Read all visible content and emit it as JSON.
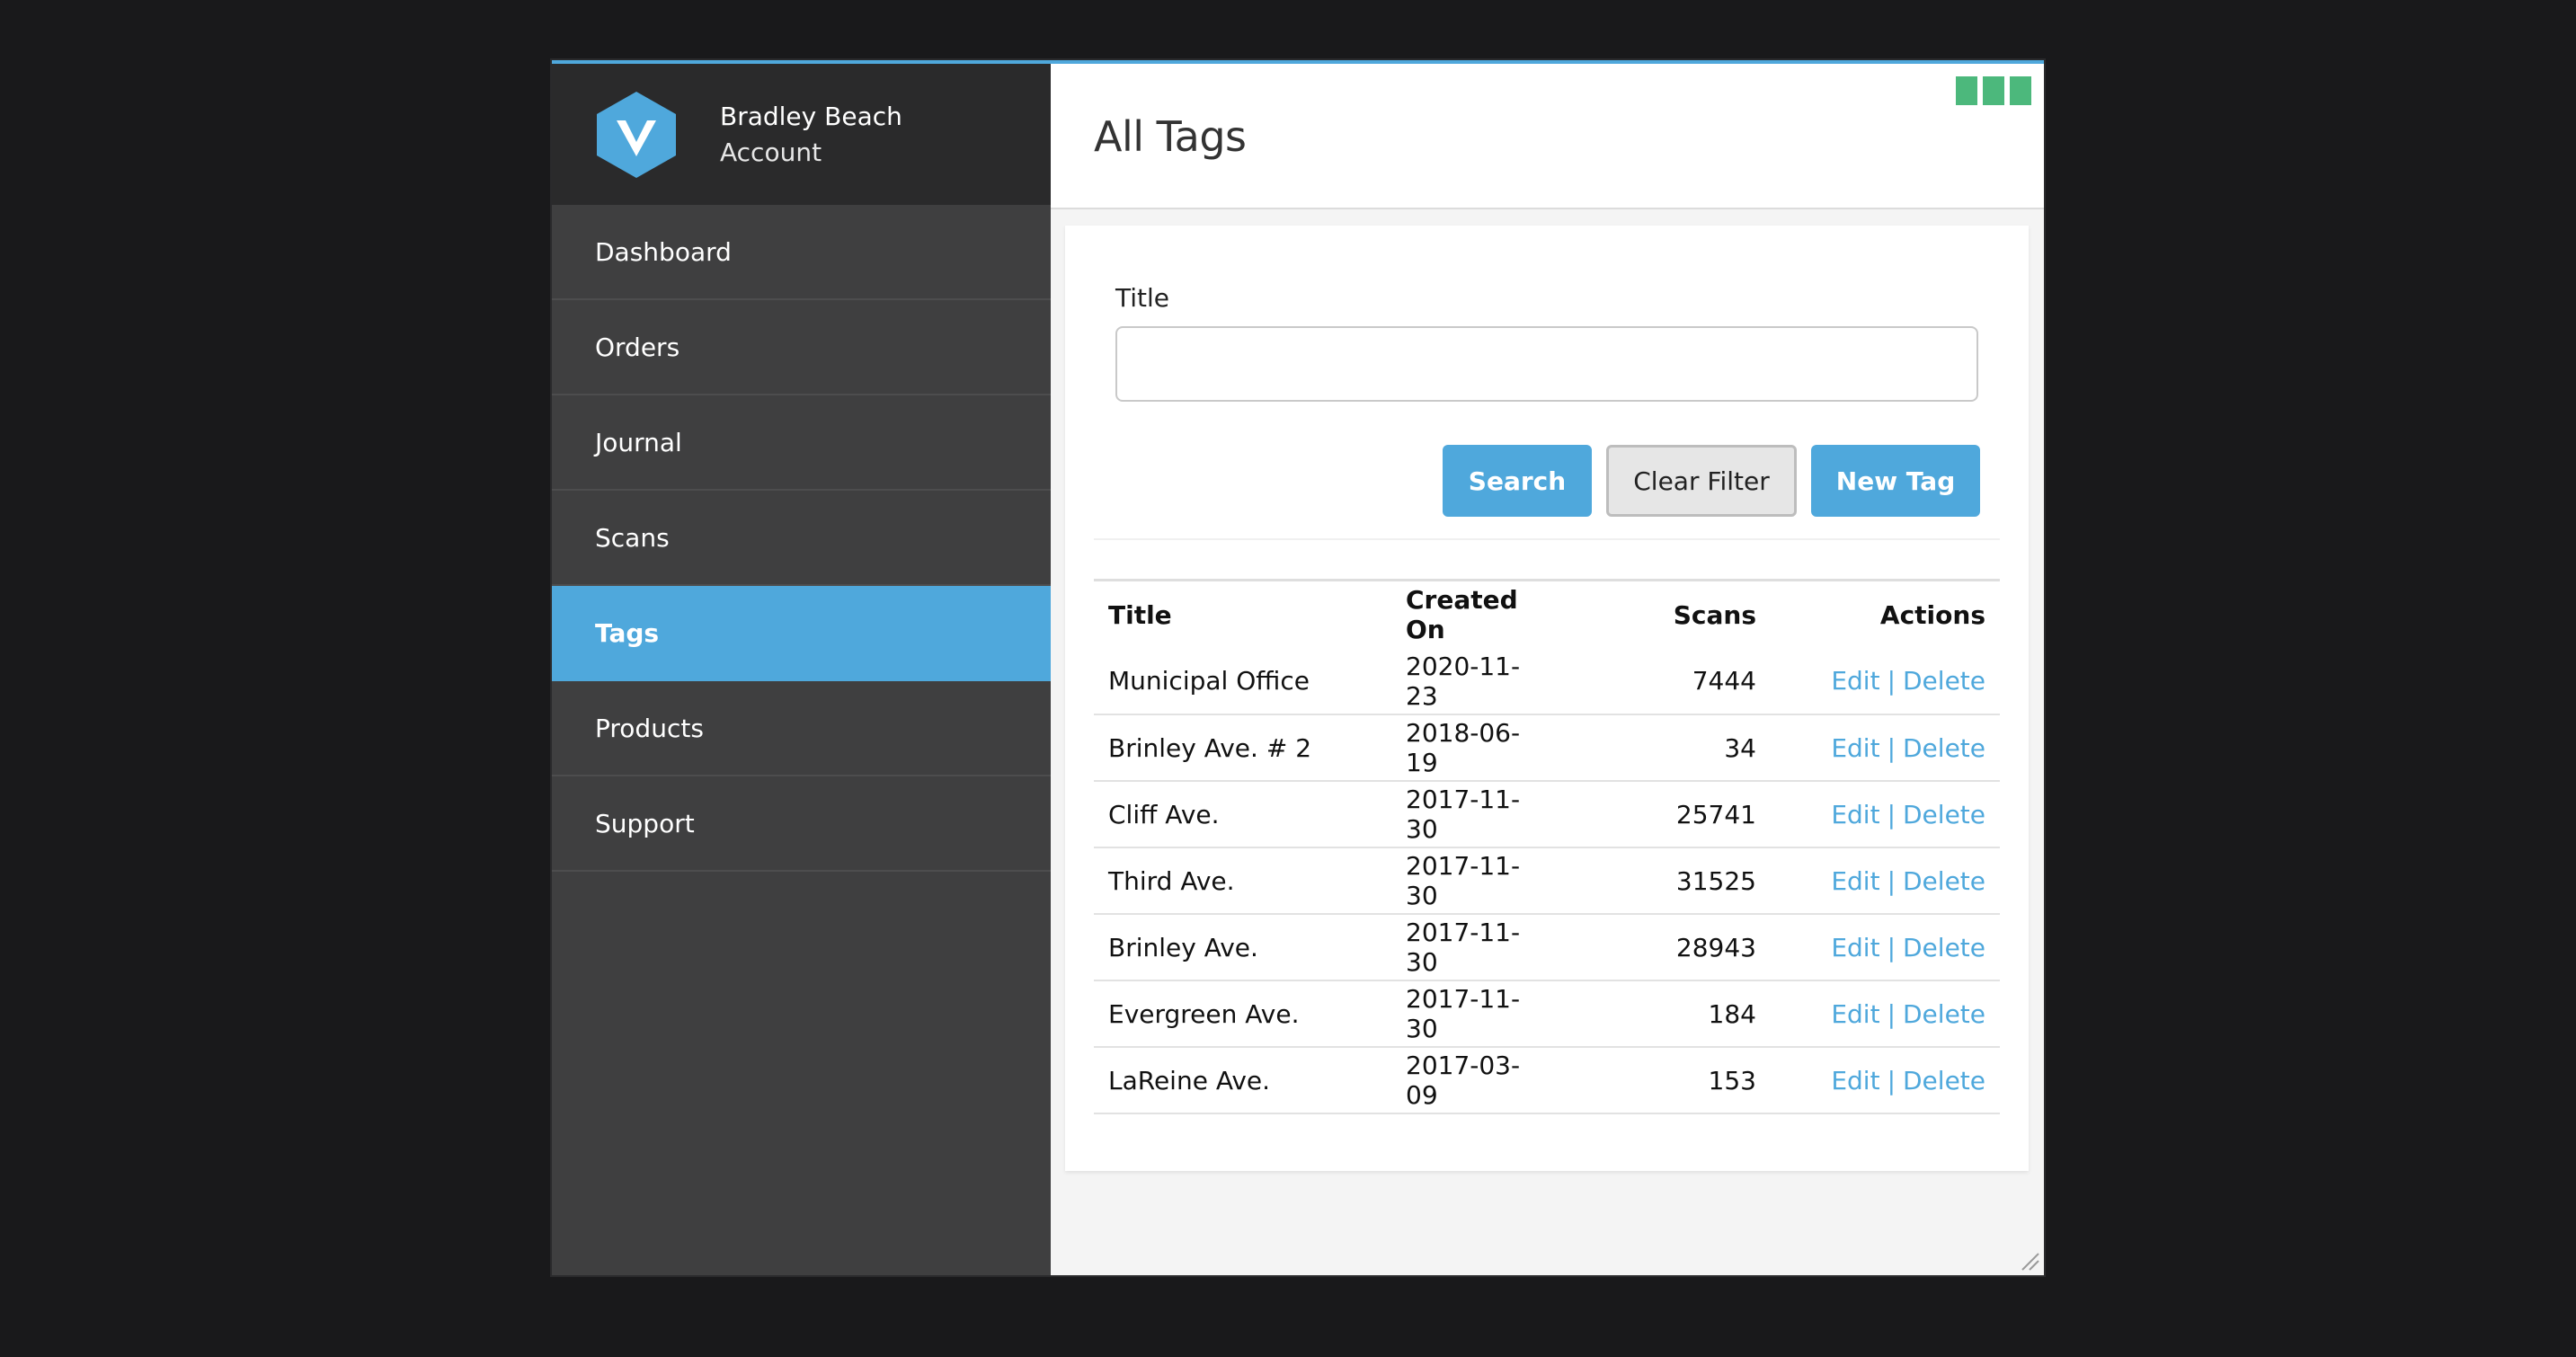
{
  "brand": {
    "name": "Bradley Beach",
    "subtitle": "Account"
  },
  "sidebar": {
    "items": [
      {
        "label": "Dashboard",
        "active": false
      },
      {
        "label": "Orders",
        "active": false
      },
      {
        "label": "Journal",
        "active": false
      },
      {
        "label": "Scans",
        "active": false
      },
      {
        "label": "Tags",
        "active": true
      },
      {
        "label": "Products",
        "active": false
      },
      {
        "label": "Support",
        "active": false
      }
    ]
  },
  "page": {
    "title": "All Tags"
  },
  "filter": {
    "title_label": "Title",
    "title_value": "",
    "title_placeholder": "",
    "search_label": "Search",
    "clear_label": "Clear Filter",
    "new_label": "New Tag"
  },
  "table": {
    "headers": {
      "title": "Title",
      "created": "Created On",
      "scans": "Scans",
      "actions": "Actions"
    },
    "edit_label": "Edit",
    "separator": "|",
    "delete_label": "Delete",
    "rows": [
      {
        "title": "Municipal Office",
        "created": "2020-11-23",
        "scans": "7444"
      },
      {
        "title": "Brinley Ave. # 2",
        "created": "2018-06-19",
        "scans": "34"
      },
      {
        "title": "Cliff Ave.",
        "created": "2017-11-30",
        "scans": "25741"
      },
      {
        "title": "Third Ave.",
        "created": "2017-11-30",
        "scans": "31525"
      },
      {
        "title": "Brinley Ave.",
        "created": "2017-11-30",
        "scans": "28943"
      },
      {
        "title": "Evergreen Ave.",
        "created": "2017-11-30",
        "scans": "184"
      },
      {
        "title": "LaReine Ave.",
        "created": "2017-03-09",
        "scans": "153"
      }
    ]
  },
  "colors": {
    "accent": "#4fa8dc",
    "sidebar": "#3f3f40",
    "brand_bg": "#2a2a2b",
    "status": "#4cb87c"
  },
  "icons": {
    "logo": "v-hexagon-logo-icon",
    "status": "status-indicator-icon",
    "resize": "resize-grip-icon"
  }
}
